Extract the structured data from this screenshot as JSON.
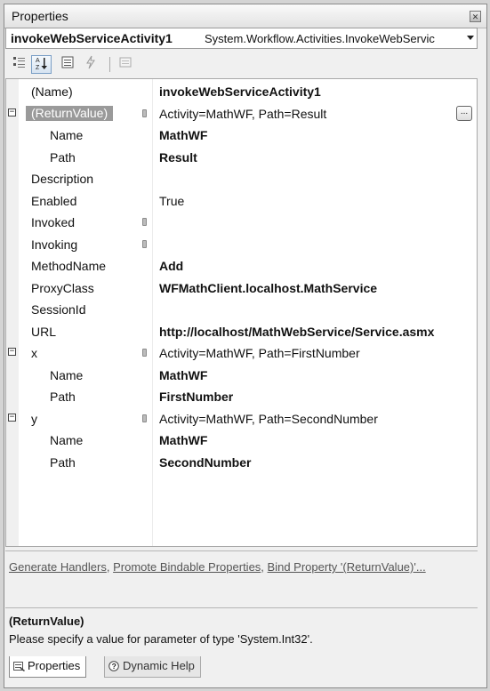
{
  "window": {
    "title": "Properties"
  },
  "object_selector": {
    "name": "invokeWebServiceActivity1",
    "type": "System.Workflow.Activities.InvokeWebServic"
  },
  "toolbar": [
    {
      "name": "categorized-icon",
      "state": "normal"
    },
    {
      "name": "alphabetical-icon",
      "state": "pressed"
    },
    {
      "name": "properties-icon",
      "state": "normal"
    },
    {
      "name": "events-icon",
      "state": "disabled"
    },
    {
      "name": "property-pages-icon",
      "state": "disabled"
    }
  ],
  "properties": [
    {
      "name": "(Name)",
      "value": "invokeWebServiceActivity1",
      "bold": true,
      "level": 0
    },
    {
      "name": "(ReturnValue)",
      "value": "Activity=MathWF, Path=Result",
      "bold": false,
      "level": 0,
      "expander": "−",
      "selected": true,
      "bind_icon": true,
      "ellipsis": "..."
    },
    {
      "name": "Name",
      "value": "MathWF",
      "bold": true,
      "level": 1
    },
    {
      "name": "Path",
      "value": "Result",
      "bold": true,
      "level": 1
    },
    {
      "name": "Description",
      "value": "",
      "bold": false,
      "level": 0
    },
    {
      "name": "Enabled",
      "value": "True",
      "bold": false,
      "level": 0
    },
    {
      "name": "Invoked",
      "value": "",
      "bold": false,
      "level": 0,
      "bind_icon": true
    },
    {
      "name": "Invoking",
      "value": "",
      "bold": false,
      "level": 0,
      "bind_icon": true
    },
    {
      "name": "MethodName",
      "value": "Add",
      "bold": true,
      "level": 0
    },
    {
      "name": "ProxyClass",
      "value": "WFMathClient.localhost.MathService",
      "bold": true,
      "level": 0
    },
    {
      "name": "SessionId",
      "value": "",
      "bold": false,
      "level": 0
    },
    {
      "name": "URL",
      "value": "http://localhost/MathWebService/Service.asmx",
      "bold": true,
      "level": 0
    },
    {
      "name": "x",
      "value": "Activity=MathWF, Path=FirstNumber",
      "bold": false,
      "level": 0,
      "expander": "−",
      "bind_icon": true
    },
    {
      "name": "Name",
      "value": "MathWF",
      "bold": true,
      "level": 1
    },
    {
      "name": "Path",
      "value": "FirstNumber",
      "bold": true,
      "level": 1
    },
    {
      "name": "y",
      "value": "Activity=MathWF, Path=SecondNumber",
      "bold": false,
      "level": 0,
      "expander": "−",
      "bind_icon": true
    },
    {
      "name": "Name",
      "value": "MathWF",
      "bold": true,
      "level": 1
    },
    {
      "name": "Path",
      "value": "SecondNumber",
      "bold": true,
      "level": 1
    }
  ],
  "commands": {
    "generate_handlers": "Generate Handlers",
    "sep1": ",",
    "promote": "Promote Bindable Properties",
    "sep2": ",",
    "bind": "Bind Property '(ReturnValue)'..."
  },
  "description": {
    "title": "(ReturnValue)",
    "text": "Please specify a value for parameter of type 'System.Int32'."
  },
  "tabs": {
    "properties": "Properties",
    "dynamic_help": "Dynamic Help"
  }
}
